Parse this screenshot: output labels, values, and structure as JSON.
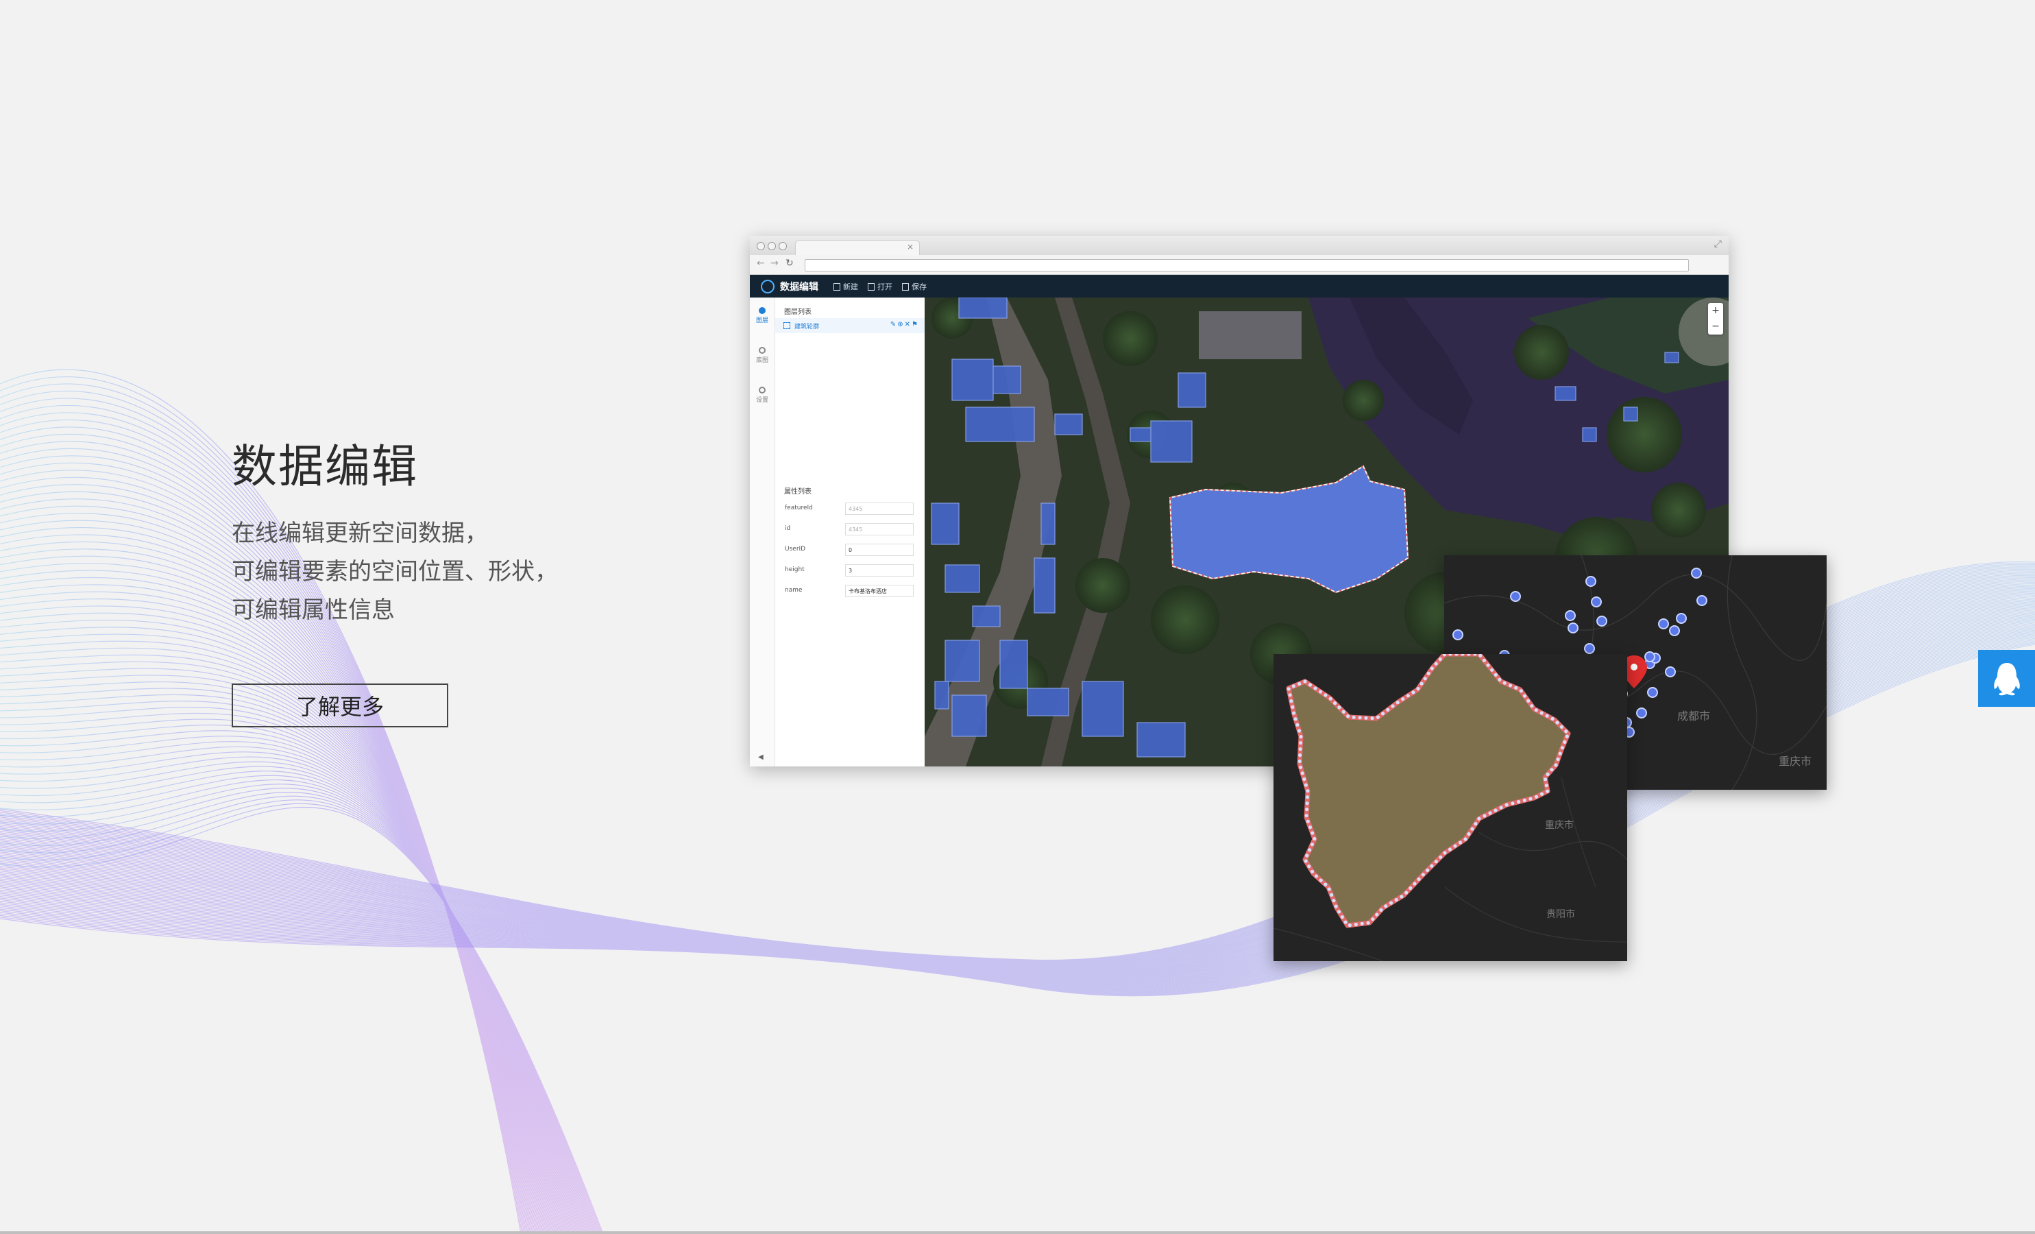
{
  "hero": {
    "title": "数据编辑",
    "description_lines": [
      "在线编辑更新空间数据，",
      "可编辑要素的空间位置、形状，",
      "可编辑属性信息"
    ],
    "cta_label": "了解更多"
  },
  "app": {
    "title": "数据编辑",
    "toolbar": [
      "新建",
      "打开",
      "保存"
    ],
    "rail": [
      {
        "label": "图层",
        "active": true
      },
      {
        "label": "底图",
        "active": false
      },
      {
        "label": "设置",
        "active": false
      }
    ],
    "layer_list_title": "图层列表",
    "layer_name": "建筑轮廓",
    "attr_list_title": "属性列表",
    "attributes": [
      {
        "key": "featureId",
        "value": "4345",
        "muted": true
      },
      {
        "key": "id",
        "value": "4345",
        "muted": true
      },
      {
        "key": "UserID",
        "value": "0",
        "muted": false
      },
      {
        "key": "height",
        "value": "3",
        "muted": false
      },
      {
        "key": "name",
        "value": "卡布基洛布酒店",
        "muted": false
      }
    ]
  },
  "maps": {
    "points_labels": [
      "成都市",
      "重庆市"
    ],
    "polygon_labels": [
      "重庆市",
      "贵阳市"
    ]
  },
  "colors": {
    "accent": "#1e7ed6",
    "header": "#152433",
    "qq": "#1f8ee6",
    "dark_map": "#242424",
    "polygon_fill": "#7d6f4c",
    "polygon_edge": "#e06a6a",
    "point": "#5a78e8",
    "marker": "#e02d2d"
  },
  "icons": {
    "qq": "qq-penguin-icon",
    "marker": "map-pin-icon"
  }
}
